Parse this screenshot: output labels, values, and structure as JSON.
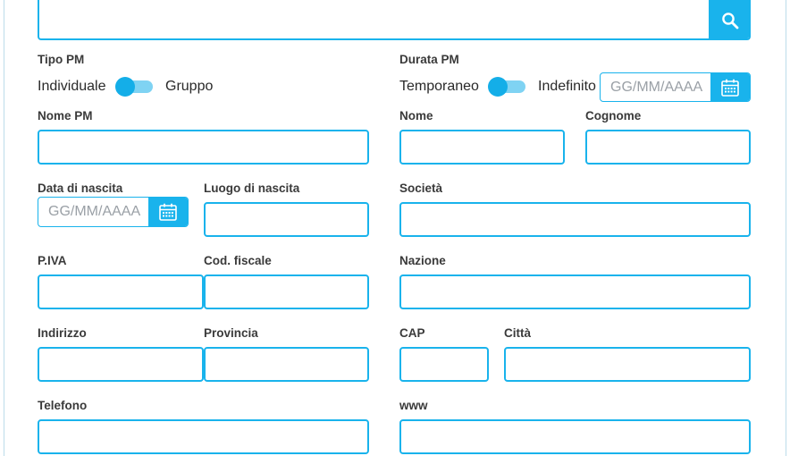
{
  "search": {
    "value": "",
    "button_icon": "search-icon"
  },
  "tipo_pm": {
    "label": "Tipo PM",
    "option_left": "Individuale",
    "option_right": "Gruppo",
    "selected": "Individuale"
  },
  "durata_pm": {
    "label": "Durata PM",
    "option_left": "Temporaneo",
    "option_right": "Indefinito",
    "selected": "Temporaneo",
    "date_placeholder": "GG/MM/AAAA"
  },
  "fields": {
    "nome_pm": {
      "label": "Nome PM",
      "value": ""
    },
    "nome": {
      "label": "Nome",
      "value": ""
    },
    "cognome": {
      "label": "Cognome",
      "value": ""
    },
    "data_nascita": {
      "label": "Data di nascita",
      "placeholder": "GG/MM/AAAA"
    },
    "luogo_nascita": {
      "label": "Luogo di nascita",
      "value": ""
    },
    "societa": {
      "label": "Società",
      "value": ""
    },
    "piva": {
      "label": "P.IVA",
      "value": ""
    },
    "cod_fiscale": {
      "label": "Cod. fiscale",
      "value": ""
    },
    "nazione": {
      "label": "Nazione",
      "value": ""
    },
    "indirizzo": {
      "label": "Indirizzo",
      "value": ""
    },
    "provincia": {
      "label": "Provincia",
      "value": ""
    },
    "cap": {
      "label": "CAP",
      "value": ""
    },
    "citta": {
      "label": "Città",
      "value": ""
    },
    "telefono": {
      "label": "Telefono",
      "value": ""
    },
    "www": {
      "label": "www",
      "value": ""
    }
  },
  "colors": {
    "accent": "#19b3ec",
    "toggle_track": "#7fd3f3"
  }
}
